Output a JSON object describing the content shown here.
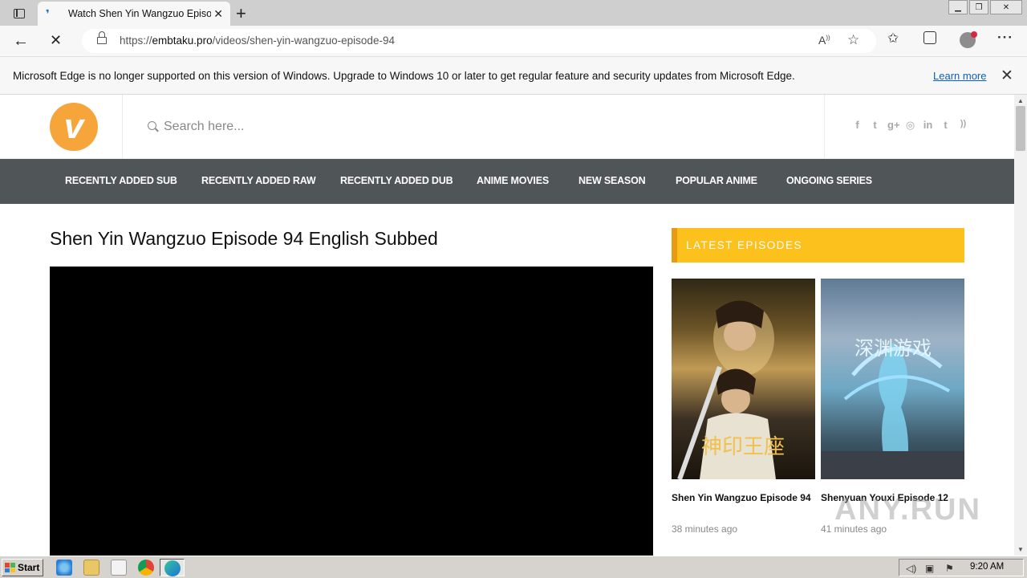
{
  "browser": {
    "tab_title": "Watch Shen Yin Wangzuo Episode 94 English Subbed",
    "url_scheme": "https://",
    "url_host": "embtaku.pro",
    "url_path": "/videos/shen-yin-wangzuo-episode-94",
    "infobar_text": "Microsoft Edge is no longer supported on this version of Windows. Upgrade to Windows 10 or later to get regular feature and security updates from Microsoft Edge.",
    "infobar_link": "Learn more"
  },
  "site": {
    "logo_letter": "v",
    "search_placeholder": "Search here...",
    "social": [
      "f",
      "t",
      "g+",
      "◎",
      "in",
      "t",
      "rss"
    ],
    "nav": [
      "RECENTLY ADDED SUB",
      "RECENTLY ADDED RAW",
      "RECENTLY ADDED DUB",
      "ANIME MOVIES",
      "NEW SEASON",
      "POPULAR ANIME",
      "ONGOING SERIES"
    ]
  },
  "main": {
    "video_title": "Shen Yin Wangzuo Episode 94 English Subbed"
  },
  "sidebar": {
    "heading": "LATEST EPISODES",
    "episodes": [
      {
        "title": "Shen Yin Wangzuo Episode 94",
        "time": "38 minutes ago"
      },
      {
        "title": "Shenyuan Youxi Episode 12",
        "time": "41 minutes ago"
      }
    ]
  },
  "watermark": "ANY.RUN",
  "taskbar": {
    "start_label": "Start",
    "clock": "9:20 AM"
  },
  "colors": {
    "accent_yellow": "#fcc11d",
    "nav_bg": "#505558",
    "logo_orange": "#f6a53b"
  }
}
